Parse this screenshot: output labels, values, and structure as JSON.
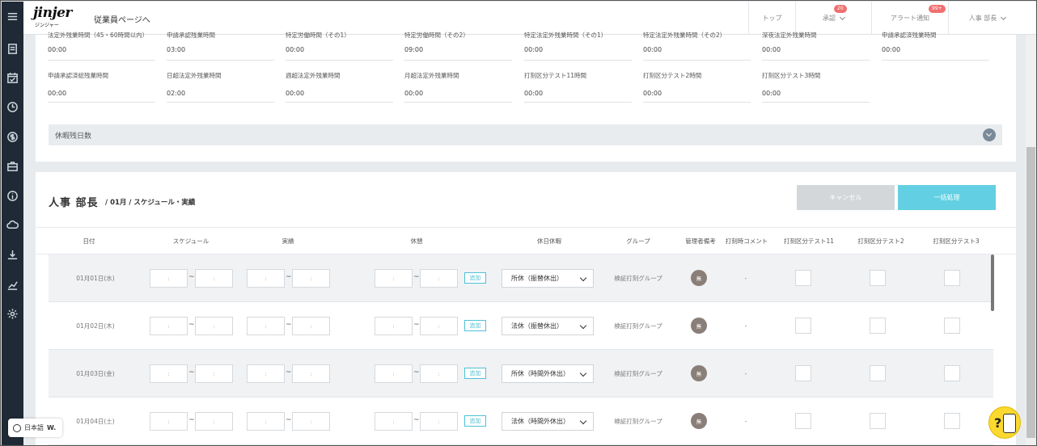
{
  "header": {
    "logo_main": "jinjer",
    "logo_sub": "ジンジャー",
    "employee_page_link": "従業員ページへ",
    "nav": {
      "top": "トップ",
      "approval": "承認",
      "approval_badge": "20",
      "alerts": "アラート通知",
      "alerts_badge": "99+",
      "user": "人事 部長"
    }
  },
  "sidebar": {
    "icons": [
      "menu-icon",
      "clipboard-icon",
      "calendar-check-icon",
      "clock-icon",
      "dollar-icon",
      "briefcase-icon",
      "info-icon",
      "cloud-icon",
      "download-icon",
      "chart-icon",
      "gear-icon"
    ]
  },
  "summary_fields": [
    {
      "label": "法定外残業時間（45・60時間以内）",
      "value": "00:00"
    },
    {
      "label": "申請承認残業時間",
      "value": "03:00"
    },
    {
      "label": "特定労働時間（その1）",
      "value": "00:00"
    },
    {
      "label": "特定労働時間（その2）",
      "value": "09:00"
    },
    {
      "label": "特定法定外残業時間（その1）",
      "value": "00:00"
    },
    {
      "label": "特定法定外残業時間（その2）",
      "value": "00:00"
    },
    {
      "label": "深夜法定外残業時間",
      "value": "00:00"
    },
    {
      "label": "申請承認済残業時間",
      "value": "00:00"
    },
    {
      "label": "申請承認済総残業時間",
      "value": "00:00"
    },
    {
      "label": "日超法定外残業時間",
      "value": "02:00"
    },
    {
      "label": "週超法定外残業時間",
      "value": "00:00"
    },
    {
      "label": "月超法定外残業時間",
      "value": "00:00"
    },
    {
      "label": "打刻区分テスト11時間",
      "value": "00:00"
    },
    {
      "label": "打刻区分テスト2時間",
      "value": "00:00"
    },
    {
      "label": "打刻区分テスト3時間",
      "value": "00:00"
    }
  ],
  "leave_section": {
    "label": "休暇残日数"
  },
  "schedule": {
    "user_name": "人事 部長",
    "breadcrumb": "/ 01月 / スケジュール・実績",
    "cancel_label": "キャンセル",
    "bulk_label": "一括処理",
    "columns": [
      "日付",
      "スケジュール",
      "実績",
      "休憩",
      "休日休暇",
      "グループ",
      "管理者備考",
      "打刻時コメント",
      "打刻区分テスト11",
      "打刻区分テスト2",
      "打刻区分テスト3"
    ],
    "time_placeholder": ":",
    "tilde": "~",
    "add_label": "追加",
    "manager_badge": "無",
    "comment_placeholder": "-",
    "rows": [
      {
        "date": "01月01日(水)",
        "holiday": "所休（振替休出）",
        "group": "検証打刻グループ"
      },
      {
        "date": "01月02日(木)",
        "holiday": "法休（振替休出）",
        "group": "検証打刻グループ"
      },
      {
        "date": "01月03日(金)",
        "holiday": "所休（時間外休出）",
        "group": "検証打刻グループ"
      },
      {
        "date": "01月04日(土)",
        "holiday": "法休（時間外休出）",
        "group": "検証打刻グループ"
      }
    ]
  },
  "footer": {
    "language": "日本語",
    "language_mark": "W.",
    "help_mark": "?"
  }
}
